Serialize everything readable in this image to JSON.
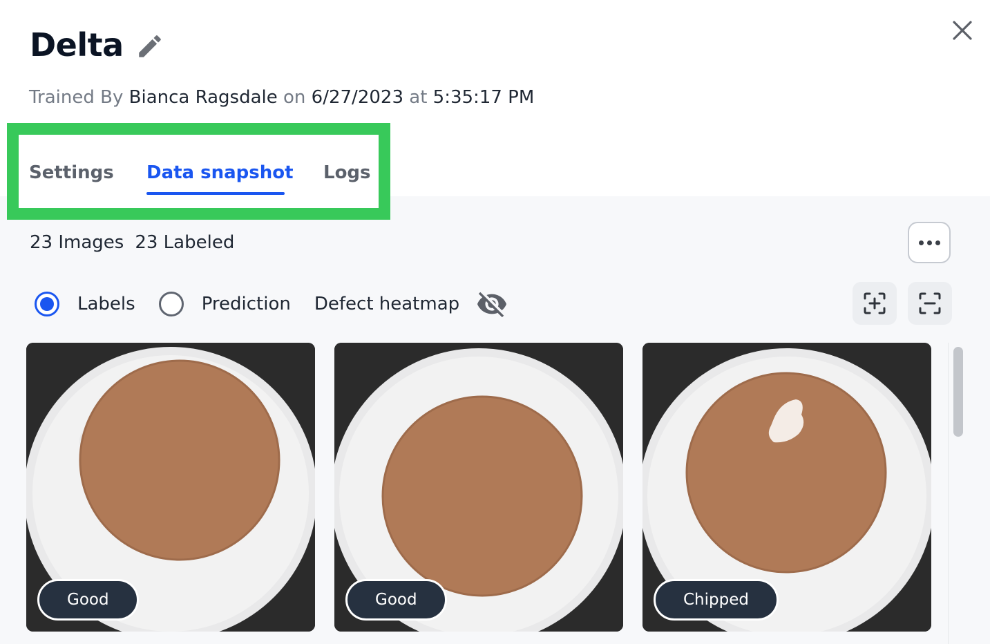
{
  "header": {
    "title": "Delta",
    "trained_prefix": "Trained By",
    "trainer": "Bianca Ragsdale",
    "on_word": "on",
    "date": "6/27/2023",
    "at_word": "at",
    "time": "5:35:17 PM"
  },
  "tabs": [
    {
      "label": "Settings",
      "active": false
    },
    {
      "label": "Data snapshot",
      "active": true
    },
    {
      "label": "Logs",
      "active": false
    }
  ],
  "snapshot": {
    "images_count": "23 Images",
    "labeled_count": "23 Labeled",
    "view_options": {
      "labels": "Labels",
      "prediction": "Prediction",
      "selected": "Labels"
    },
    "heatmap_label": "Defect heatmap",
    "cards": [
      {
        "label": "Good"
      },
      {
        "label": "Good"
      },
      {
        "label": "Chipped"
      }
    ]
  },
  "icons": {
    "edit": "pencil-icon",
    "close": "close-icon",
    "more": "more-horizontal-icon",
    "heatmap_toggle": "eye-off-icon",
    "zoom_in": "zoom-in-frame-icon",
    "zoom_out": "zoom-out-frame-icon"
  },
  "colors": {
    "accent": "#1a56f0",
    "highlight_box": "#38c95a",
    "badge_bg": "#263140",
    "pellet": "#b07a57"
  }
}
